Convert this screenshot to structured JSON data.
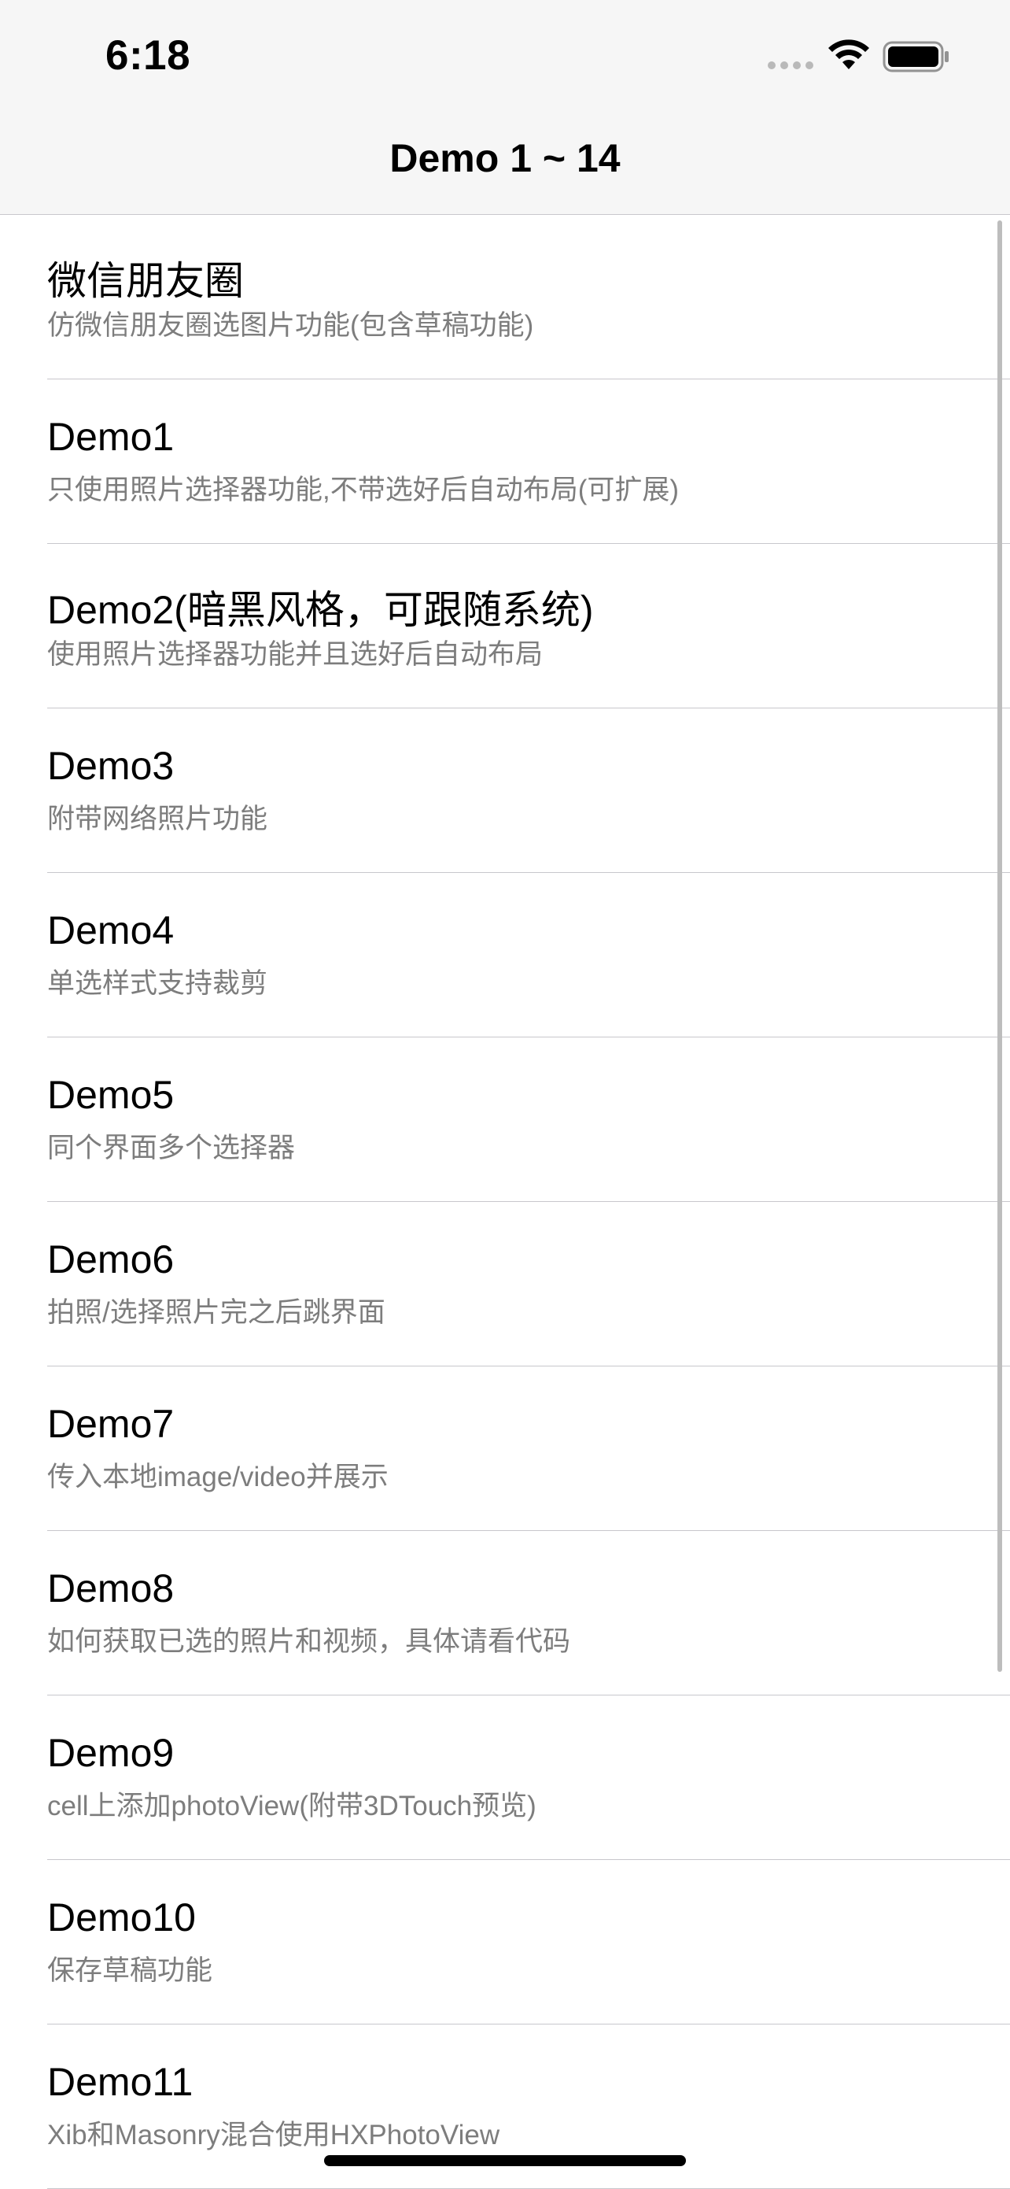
{
  "status_bar": {
    "time": "6:18"
  },
  "nav": {
    "title": "Demo 1 ~ 14"
  },
  "list": [
    {
      "title": "微信朋友圈",
      "subtitle": "仿微信朋友圈选图片功能(包含草稿功能)"
    },
    {
      "title": "Demo1",
      "subtitle": "只使用照片选择器功能,不带选好后自动布局(可扩展)"
    },
    {
      "title": "Demo2(暗黑风格，可跟随系统)",
      "subtitle": "使用照片选择器功能并且选好后自动布局"
    },
    {
      "title": "Demo3",
      "subtitle": "附带网络照片功能"
    },
    {
      "title": "Demo4",
      "subtitle": "单选样式支持裁剪"
    },
    {
      "title": "Demo5",
      "subtitle": "同个界面多个选择器"
    },
    {
      "title": "Demo6",
      "subtitle": "拍照/选择照片完之后跳界面"
    },
    {
      "title": "Demo7",
      "subtitle": "传入本地image/video并展示"
    },
    {
      "title": "Demo8",
      "subtitle": "如何获取已选的照片和视频，具体请看代码"
    },
    {
      "title": "Demo9",
      "subtitle": "cell上添加photoView(附带3DTouch预览)"
    },
    {
      "title": "Demo10",
      "subtitle": "保存草稿功能"
    },
    {
      "title": "Demo11",
      "subtitle": "Xib和Masonry混合使用HXPhotoView"
    }
  ]
}
